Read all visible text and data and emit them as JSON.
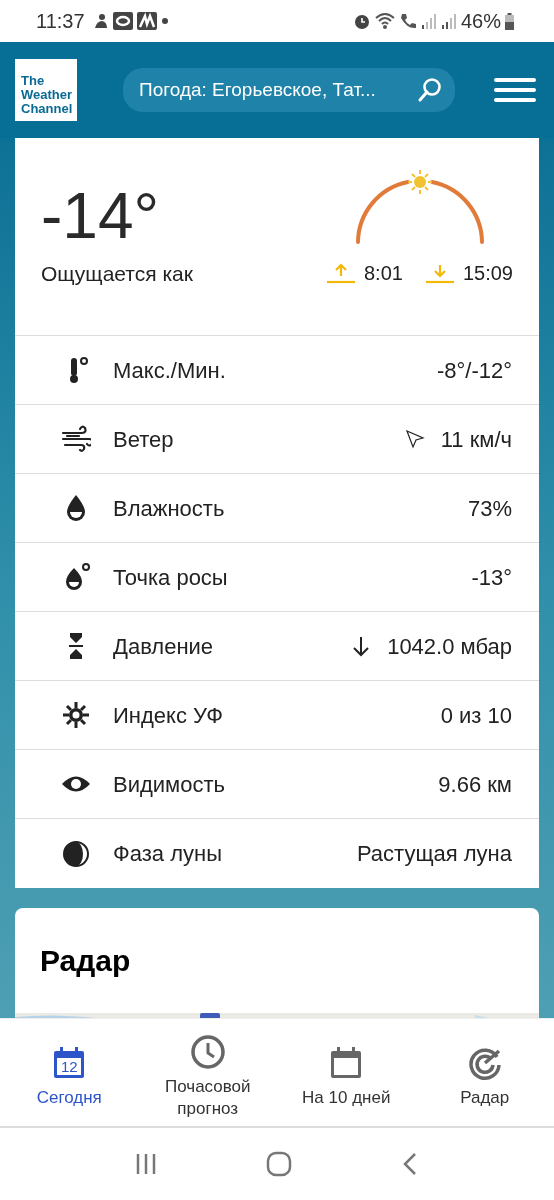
{
  "status_bar": {
    "time": "11:37",
    "battery": "46%"
  },
  "header": {
    "logo": [
      "The",
      "Weather",
      "Channel"
    ],
    "search": {
      "value": "Погода: Егорьевское, Тат..."
    }
  },
  "current": {
    "temperature": "-14°",
    "feels_like": "Ощущается как",
    "sunrise": "8:01",
    "sunset": "15:09"
  },
  "details": [
    {
      "kind": "plain",
      "label": "Макс./Мин.",
      "value": "-8°/-12°"
    },
    {
      "kind": "direction",
      "label": "Ветер",
      "value": "11 км/ч"
    },
    {
      "kind": "plain",
      "label": "Влажность",
      "value": "73%"
    },
    {
      "kind": "plain",
      "label": "Точка росы",
      "value": "-13°"
    },
    {
      "kind": "trend",
      "label": "Давление",
      "value": "1042.0 мбар"
    },
    {
      "kind": "plain",
      "label": "Индекс УФ",
      "value": "0 из 10"
    },
    {
      "kind": "plain",
      "label": "Видимость",
      "value": "9.66 км"
    },
    {
      "kind": "plain",
      "label": "Фаза луны",
      "value": "Растущая луна"
    }
  ],
  "radar": {
    "title": "Радар"
  },
  "tabs": [
    {
      "label": "Сегодня",
      "selected": true,
      "icon_text": "12"
    },
    {
      "label": "Почасовой прогноз",
      "selected": false
    },
    {
      "label": "На 10 дней",
      "selected": false
    },
    {
      "label": "Радар",
      "selected": false
    }
  ]
}
